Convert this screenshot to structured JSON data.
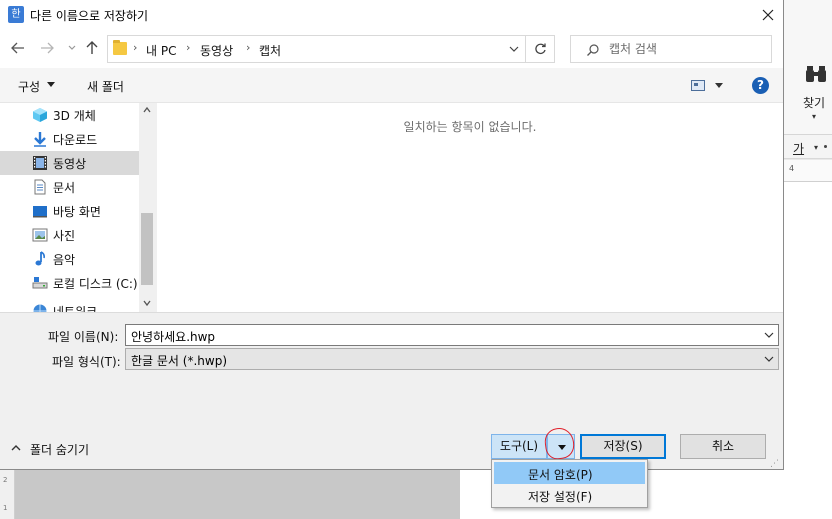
{
  "dialog": {
    "title": "다른 이름으로 저장하기",
    "app_icon_glyph": "한"
  },
  "navigation": {
    "breadcrumbs": [
      "내 PC",
      "동영상",
      "캡처"
    ],
    "search_placeholder": "캡처 검색"
  },
  "toolbar": {
    "organize_label": "구성",
    "new_folder_label": "새 폴더",
    "help_label": "?"
  },
  "sidebar": {
    "items": [
      {
        "label": "3D 개체",
        "icon": "cube-icon",
        "selected": false
      },
      {
        "label": "다운로드",
        "icon": "download-arrow-icon",
        "selected": false
      },
      {
        "label": "동영상",
        "icon": "film-icon",
        "selected": true
      },
      {
        "label": "문서",
        "icon": "document-icon",
        "selected": false
      },
      {
        "label": "바탕 화면",
        "icon": "desktop-icon",
        "selected": false
      },
      {
        "label": "사진",
        "icon": "picture-icon",
        "selected": false
      },
      {
        "label": "음악",
        "icon": "music-note-icon",
        "selected": false
      },
      {
        "label": "로컬 디스크 (C:)",
        "icon": "drive-icon",
        "selected": false
      },
      {
        "label": "네트워크",
        "icon": "network-icon",
        "selected": false
      }
    ]
  },
  "content": {
    "empty_message": "일치하는 항목이 없습니다."
  },
  "form": {
    "filename_label": "파일 이름(N):",
    "filename_value": "안녕하세요.hwp",
    "filetype_label": "파일 형식(T):",
    "filetype_value": "한글 문서 (*.hwp)"
  },
  "footer": {
    "hide_folders_label": "폴더 숨기기",
    "tools_label": "도구(L)",
    "save_label": "저장(S)",
    "cancel_label": "취소"
  },
  "tools_menu": {
    "items": [
      {
        "label": "문서 암호(P)",
        "highlighted": true
      },
      {
        "label": "저장 설정(F)",
        "highlighted": false
      }
    ]
  },
  "background_app": {
    "find_label": "찾기",
    "font_label": "가",
    "ruler_number": "4",
    "side_marks": [
      "2",
      "1"
    ]
  },
  "colors": {
    "accent": "#0078d7",
    "selection": "#d9d9d9",
    "menu_highlight": "#91c9f7",
    "annotation_red": "#e0202a"
  }
}
